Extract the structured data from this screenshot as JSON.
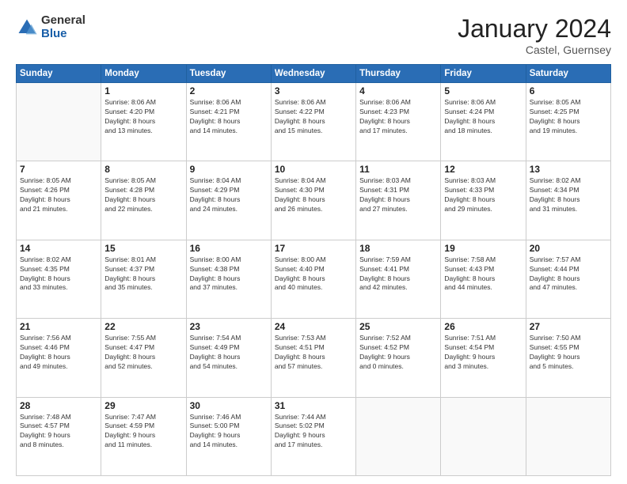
{
  "header": {
    "logo_general": "General",
    "logo_blue": "Blue",
    "month_title": "January 2024",
    "location": "Castel, Guernsey"
  },
  "weekdays": [
    "Sunday",
    "Monday",
    "Tuesday",
    "Wednesday",
    "Thursday",
    "Friday",
    "Saturday"
  ],
  "weeks": [
    [
      {
        "day": "",
        "info": ""
      },
      {
        "day": "1",
        "info": "Sunrise: 8:06 AM\nSunset: 4:20 PM\nDaylight: 8 hours\nand 13 minutes."
      },
      {
        "day": "2",
        "info": "Sunrise: 8:06 AM\nSunset: 4:21 PM\nDaylight: 8 hours\nand 14 minutes."
      },
      {
        "day": "3",
        "info": "Sunrise: 8:06 AM\nSunset: 4:22 PM\nDaylight: 8 hours\nand 15 minutes."
      },
      {
        "day": "4",
        "info": "Sunrise: 8:06 AM\nSunset: 4:23 PM\nDaylight: 8 hours\nand 17 minutes."
      },
      {
        "day": "5",
        "info": "Sunrise: 8:06 AM\nSunset: 4:24 PM\nDaylight: 8 hours\nand 18 minutes."
      },
      {
        "day": "6",
        "info": "Sunrise: 8:05 AM\nSunset: 4:25 PM\nDaylight: 8 hours\nand 19 minutes."
      }
    ],
    [
      {
        "day": "7",
        "info": "Sunrise: 8:05 AM\nSunset: 4:26 PM\nDaylight: 8 hours\nand 21 minutes."
      },
      {
        "day": "8",
        "info": "Sunrise: 8:05 AM\nSunset: 4:28 PM\nDaylight: 8 hours\nand 22 minutes."
      },
      {
        "day": "9",
        "info": "Sunrise: 8:04 AM\nSunset: 4:29 PM\nDaylight: 8 hours\nand 24 minutes."
      },
      {
        "day": "10",
        "info": "Sunrise: 8:04 AM\nSunset: 4:30 PM\nDaylight: 8 hours\nand 26 minutes."
      },
      {
        "day": "11",
        "info": "Sunrise: 8:03 AM\nSunset: 4:31 PM\nDaylight: 8 hours\nand 27 minutes."
      },
      {
        "day": "12",
        "info": "Sunrise: 8:03 AM\nSunset: 4:33 PM\nDaylight: 8 hours\nand 29 minutes."
      },
      {
        "day": "13",
        "info": "Sunrise: 8:02 AM\nSunset: 4:34 PM\nDaylight: 8 hours\nand 31 minutes."
      }
    ],
    [
      {
        "day": "14",
        "info": "Sunrise: 8:02 AM\nSunset: 4:35 PM\nDaylight: 8 hours\nand 33 minutes."
      },
      {
        "day": "15",
        "info": "Sunrise: 8:01 AM\nSunset: 4:37 PM\nDaylight: 8 hours\nand 35 minutes."
      },
      {
        "day": "16",
        "info": "Sunrise: 8:00 AM\nSunset: 4:38 PM\nDaylight: 8 hours\nand 37 minutes."
      },
      {
        "day": "17",
        "info": "Sunrise: 8:00 AM\nSunset: 4:40 PM\nDaylight: 8 hours\nand 40 minutes."
      },
      {
        "day": "18",
        "info": "Sunrise: 7:59 AM\nSunset: 4:41 PM\nDaylight: 8 hours\nand 42 minutes."
      },
      {
        "day": "19",
        "info": "Sunrise: 7:58 AM\nSunset: 4:43 PM\nDaylight: 8 hours\nand 44 minutes."
      },
      {
        "day": "20",
        "info": "Sunrise: 7:57 AM\nSunset: 4:44 PM\nDaylight: 8 hours\nand 47 minutes."
      }
    ],
    [
      {
        "day": "21",
        "info": "Sunrise: 7:56 AM\nSunset: 4:46 PM\nDaylight: 8 hours\nand 49 minutes."
      },
      {
        "day": "22",
        "info": "Sunrise: 7:55 AM\nSunset: 4:47 PM\nDaylight: 8 hours\nand 52 minutes."
      },
      {
        "day": "23",
        "info": "Sunrise: 7:54 AM\nSunset: 4:49 PM\nDaylight: 8 hours\nand 54 minutes."
      },
      {
        "day": "24",
        "info": "Sunrise: 7:53 AM\nSunset: 4:51 PM\nDaylight: 8 hours\nand 57 minutes."
      },
      {
        "day": "25",
        "info": "Sunrise: 7:52 AM\nSunset: 4:52 PM\nDaylight: 9 hours\nand 0 minutes."
      },
      {
        "day": "26",
        "info": "Sunrise: 7:51 AM\nSunset: 4:54 PM\nDaylight: 9 hours\nand 3 minutes."
      },
      {
        "day": "27",
        "info": "Sunrise: 7:50 AM\nSunset: 4:55 PM\nDaylight: 9 hours\nand 5 minutes."
      }
    ],
    [
      {
        "day": "28",
        "info": "Sunrise: 7:48 AM\nSunset: 4:57 PM\nDaylight: 9 hours\nand 8 minutes."
      },
      {
        "day": "29",
        "info": "Sunrise: 7:47 AM\nSunset: 4:59 PM\nDaylight: 9 hours\nand 11 minutes."
      },
      {
        "day": "30",
        "info": "Sunrise: 7:46 AM\nSunset: 5:00 PM\nDaylight: 9 hours\nand 14 minutes."
      },
      {
        "day": "31",
        "info": "Sunrise: 7:44 AM\nSunset: 5:02 PM\nDaylight: 9 hours\nand 17 minutes."
      },
      {
        "day": "",
        "info": ""
      },
      {
        "day": "",
        "info": ""
      },
      {
        "day": "",
        "info": ""
      }
    ]
  ]
}
